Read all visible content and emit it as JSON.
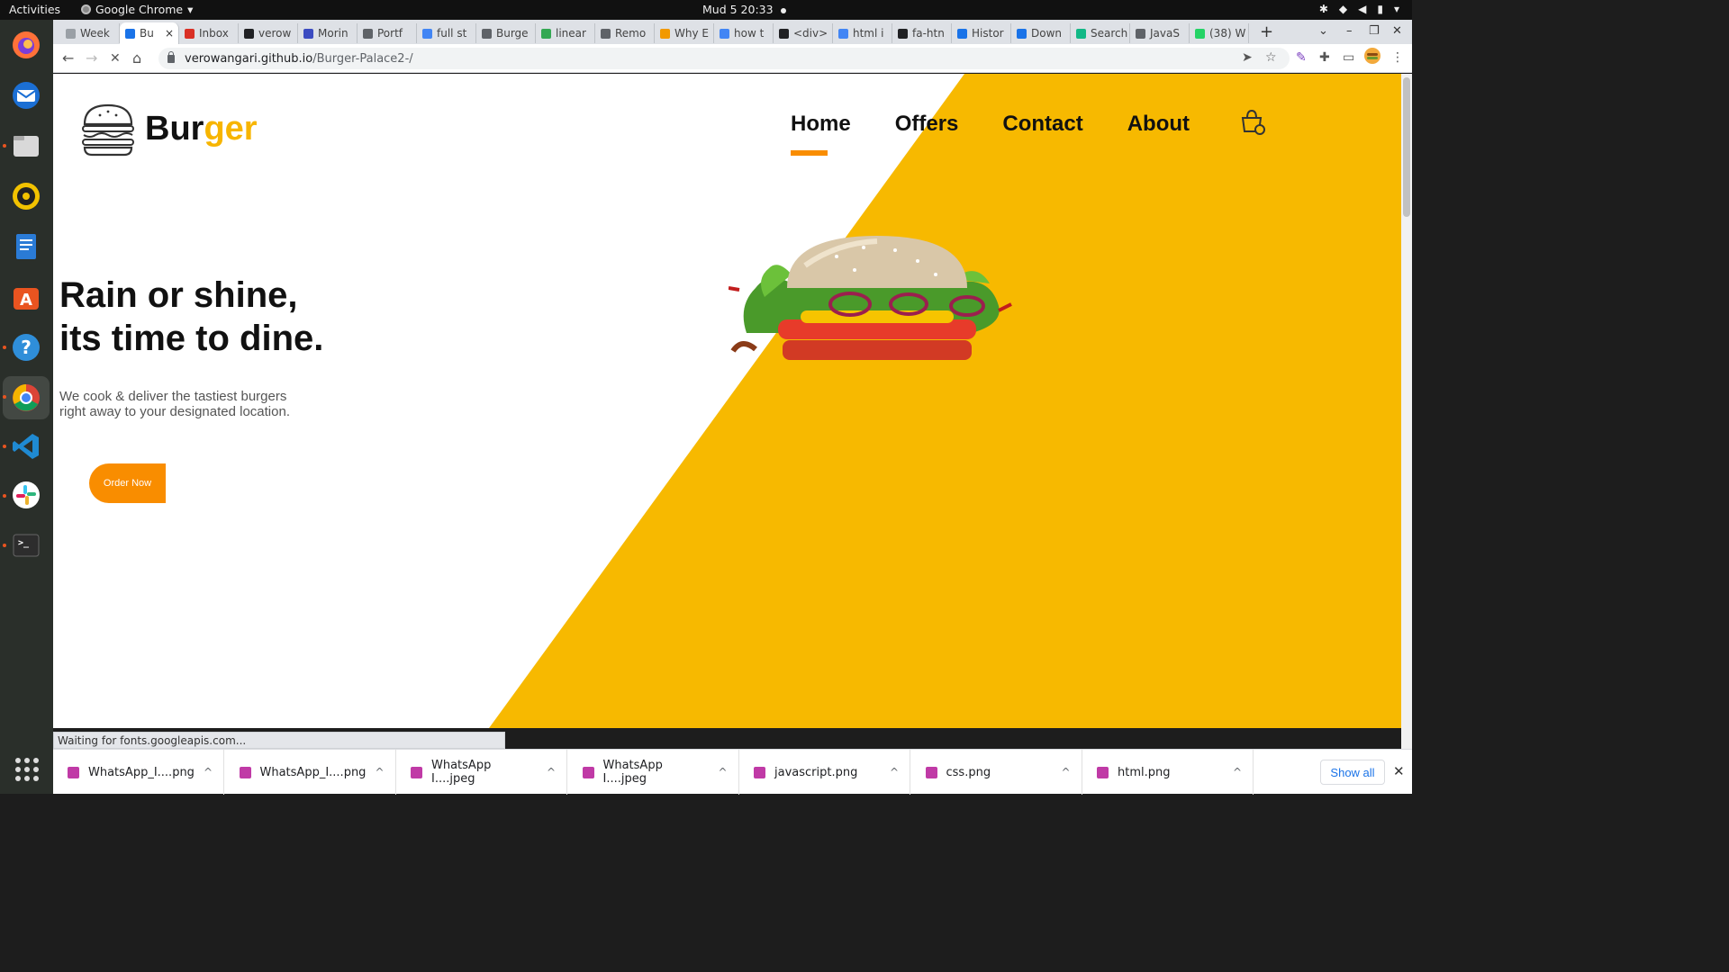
{
  "topbar": {
    "activities": "Activities",
    "app_name": "Google Chrome",
    "app_menu_glyph": "▾",
    "clock": "Mud 5  20:33",
    "tray": [
      "network-icon",
      "wifi-icon",
      "volume-icon",
      "battery-icon",
      "power-menu-icon"
    ]
  },
  "browser": {
    "tabs": [
      {
        "label": "Week",
        "color": "#9aa0a6"
      },
      {
        "label": "Bu",
        "color": "#1a73e8",
        "active": true
      },
      {
        "label": "Inbox",
        "color": "#d93025"
      },
      {
        "label": "verow",
        "color": "#202124"
      },
      {
        "label": "Morin",
        "color": "#3c4cc1"
      },
      {
        "label": "Portf",
        "color": "#5f6368"
      },
      {
        "label": "full st",
        "color": "#4285f4"
      },
      {
        "label": "Burge",
        "color": "#5f6368"
      },
      {
        "label": "linear",
        "color": "#34a853"
      },
      {
        "label": "Remo",
        "color": "#5f6368"
      },
      {
        "label": "Why E",
        "color": "#f29900"
      },
      {
        "label": "how t",
        "color": "#4285f4"
      },
      {
        "label": "<div>",
        "color": "#202124"
      },
      {
        "label": "html i",
        "color": "#4285f4"
      },
      {
        "label": "fa-htn",
        "color": "#202124"
      },
      {
        "label": "Histor",
        "color": "#1a73e8"
      },
      {
        "label": "Down",
        "color": "#1a73e8"
      },
      {
        "label": "Search",
        "color": "#12b886"
      },
      {
        "label": "JavaS",
        "color": "#5f6368"
      },
      {
        "label": "(38) W",
        "color": "#25d366"
      }
    ],
    "tab_close": "×",
    "new_tab": "+",
    "window_controls": {
      "dropdown": "⌄",
      "minimize": "–",
      "restore": "❐",
      "close": "✕"
    },
    "nav": {
      "back": "←",
      "forward": "→",
      "reload": "✕",
      "home": "⌂"
    },
    "url_host": "verowangari.github.io",
    "url_path": "/Burger-Palace2-/",
    "toolbar_icons": {
      "send": "➤",
      "bookmark": "☆",
      "eyedropper": "✎",
      "extensions": "✚",
      "cast": "▭",
      "menu": "⋮"
    },
    "status_text": "Waiting for fonts.googleapis.com..."
  },
  "site": {
    "logo_main": "Bur",
    "logo_accent": "ger",
    "nav": [
      "Home",
      "Offers",
      "Contact",
      "About"
    ],
    "hero_line1": "Rain or shine,",
    "hero_line2": "its time to dine.",
    "hero_sub_line1": "We cook & deliver the tastiest burgers",
    "hero_sub_line2": "right away to your designated location.",
    "order_button": "Order Now",
    "colors": {
      "yellow": "#f7b900",
      "orange": "#f98d00"
    }
  },
  "downloads": {
    "items": [
      "WhatsApp_I....png",
      "WhatsApp_I....png",
      "WhatsApp I....jpeg",
      "WhatsApp I....jpeg",
      "javascript.png",
      "css.png",
      "html.png"
    ],
    "chevron": "^",
    "show_all": "Show all",
    "close": "✕"
  }
}
